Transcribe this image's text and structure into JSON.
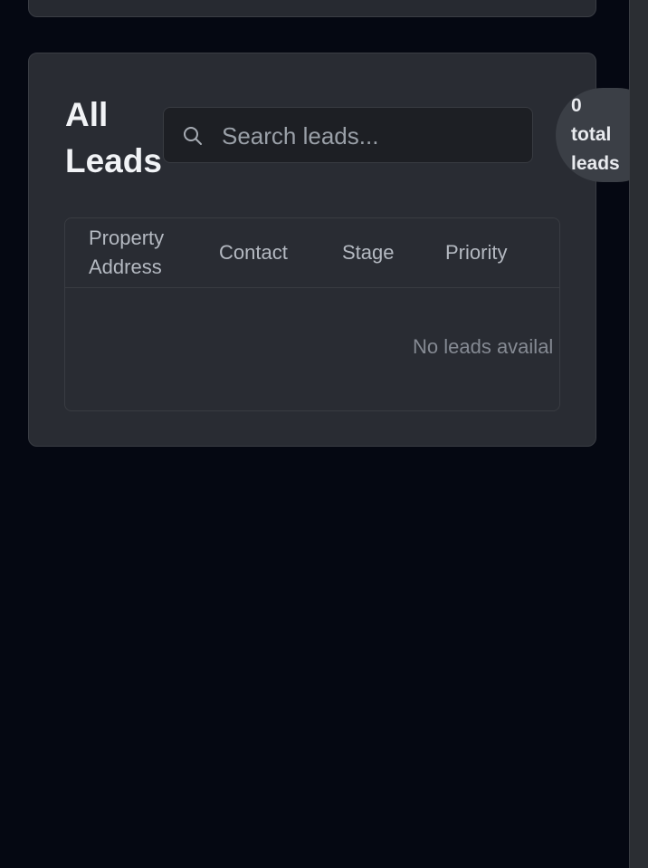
{
  "leads_panel": {
    "title": "All Leads",
    "search": {
      "placeholder": "Search leads...",
      "value": ""
    },
    "count": {
      "number": "0",
      "label_line1": "total",
      "label_line2": "leads"
    },
    "table": {
      "columns": [
        "Property Address",
        "Contact",
        "Stage",
        "Priority"
      ],
      "rows": [],
      "empty_text": "No leads availal"
    }
  },
  "icons": {
    "search": "search-icon"
  },
  "colors": {
    "page_background": "#050812",
    "card_background": "#292c33",
    "input_background": "#1d1f24",
    "badge_background": "#3b3f46",
    "title_text": "#f1f3f6",
    "header_text": "#b4b9c1",
    "muted_text": "#858a93"
  }
}
